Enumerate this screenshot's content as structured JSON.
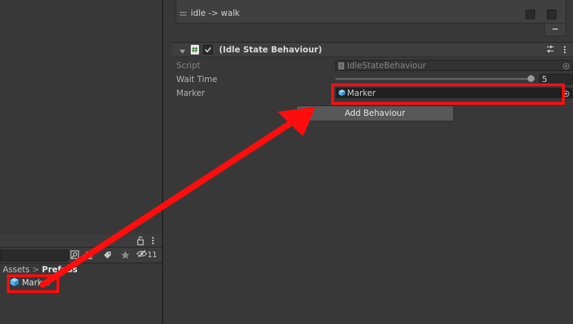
{
  "transition": {
    "label": "idle -> walk"
  },
  "component": {
    "title": "(Idle State Behaviour)",
    "script_label": "Script",
    "script_value": "IdleStateBehaviour",
    "wait_time_label": "Wait Time",
    "wait_time_value": "5",
    "wait_time_fraction": 0.98,
    "marker_label": "Marker",
    "marker_value": "Marker"
  },
  "add_behaviour_label": "Add Behaviour",
  "minus_label": "−",
  "project": {
    "breadcrumb_root": "Assets",
    "breadcrumb_sep": ">",
    "breadcrumb_current": "Prefabs",
    "hidden_count": "11",
    "items": [
      {
        "label": "Marker"
      }
    ]
  },
  "colors": {
    "highlight": "#ff0d0d",
    "prefab_icon": "#5ab4ec"
  },
  "icons": [
    "lock-icon",
    "kebab-menu-icon",
    "search-by-type-icon",
    "filter-icon",
    "tag-icon",
    "star-icon",
    "hidden-eye-icon",
    "prefab-cube-icon",
    "foldout-arrow-icon",
    "script-hash-icon",
    "checkbox-icon",
    "preset-icon",
    "object-picker-icon",
    "drag-handle-icon"
  ]
}
